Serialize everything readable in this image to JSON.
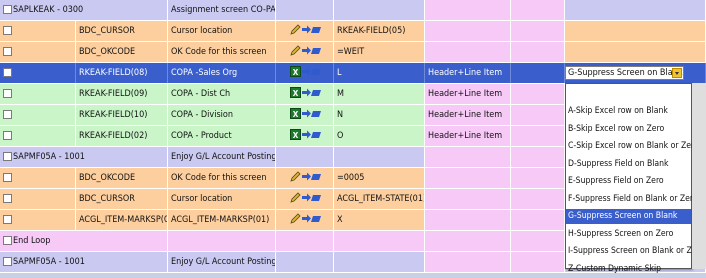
{
  "rows": [
    {
      "type": "section",
      "program": "SAPLKEAK - 0300",
      "desc": "Assignment screen CO-PA"
    },
    {
      "type": "orange",
      "field": "BDC_CURSOR",
      "desc": "Cursor location",
      "icon": "pencil-arrow-icon",
      "value": "RKEAK-FIELD(05)"
    },
    {
      "type": "orange",
      "field": "BDC_OKCODE",
      "desc": "OK Code for this screen",
      "icon": "pencil-arrow-icon",
      "value": "=WEIT"
    },
    {
      "type": "selected",
      "field": "RKEAK-FIELD(08)",
      "desc": "COPA -Sales Org",
      "icon": "excel-arrow-icon",
      "value": "L",
      "source": "Header+Line Item",
      "skip": "G-Suppress Screen on Blank"
    },
    {
      "type": "green",
      "field": "RKEAK-FIELD(09)",
      "desc": "COPA - Dist Ch",
      "icon": "excel-arrow-icon",
      "value": "M",
      "source": "Header+Line Item"
    },
    {
      "type": "green",
      "field": "RKEAK-FIELD(10)",
      "desc": "COPA - Division",
      "icon": "excel-arrow-icon",
      "value": "N",
      "source": "Header+Line Item"
    },
    {
      "type": "green",
      "field": "RKEAK-FIELD(02)",
      "desc": "COPA - Product",
      "icon": "excel-arrow-icon",
      "value": "O",
      "source": "Header+Line Item"
    },
    {
      "type": "section",
      "program": "SAPMF05A - 1001",
      "desc": "Enjoy G/L Account Posting"
    },
    {
      "type": "orange",
      "field": "BDC_OKCODE",
      "desc": "OK Code for this screen",
      "icon": "pencil-arrow-icon",
      "value": "=0005"
    },
    {
      "type": "orange",
      "field": "BDC_CURSOR",
      "desc": "Cursor location",
      "icon": "pencil-arrow-icon",
      "value": "ACGL_ITEM-STATE(01)"
    },
    {
      "type": "orange",
      "field": "ACGL_ITEM-MARKSP(01)",
      "desc": "ACGL_ITEM-MARKSP(01)",
      "icon": "pencil-arrow-icon",
      "value": "X"
    },
    {
      "type": "loop",
      "program": "End Loop"
    },
    {
      "type": "section",
      "program": "SAPMF05A - 1001",
      "desc": "Enjoy G/L Account Posting"
    }
  ],
  "dropdown": {
    "selected": "G-Suppress Screen on Blank",
    "options": [
      "A-Skip Excel row on Blank",
      "B-Skip Excel row on Zero",
      "C-Skip Excel row on Blank or Zero",
      "D-Suppress Field on Blank",
      "E-Suppress Field on Zero",
      "F-Suppress Field on Blank or Zero",
      "G-Suppress Screen on Blank",
      "H-Suppress Screen on Zero",
      "I-Suppress Screen on Blank or Zero",
      "Z-Custom Dynamic Skip"
    ]
  }
}
